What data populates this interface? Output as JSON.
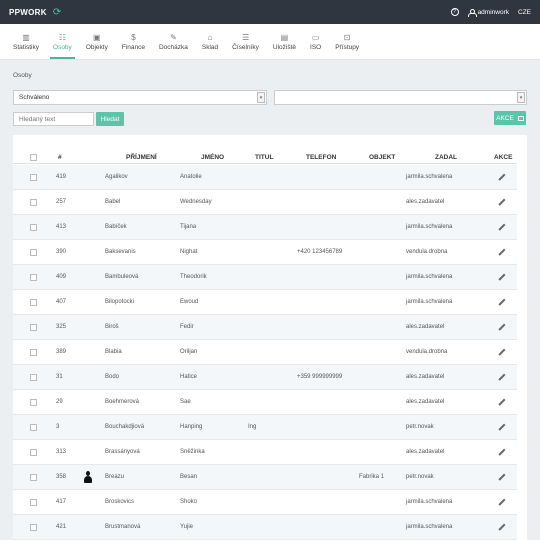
{
  "app": {
    "brand": "PPWORK",
    "username": "adminwork",
    "language": "CZE"
  },
  "nav": [
    {
      "label": "Statistiky",
      "icon": "bar-chart-icon",
      "glyph": "▥"
    },
    {
      "label": "Osoby",
      "icon": "people-icon",
      "glyph": "☷",
      "active": true
    },
    {
      "label": "Objekty",
      "icon": "building-icon",
      "glyph": "▣"
    },
    {
      "label": "Finance",
      "icon": "dollar-icon",
      "glyph": "$"
    },
    {
      "label": "Docházka",
      "icon": "pen-icon",
      "glyph": "✎"
    },
    {
      "label": "Sklad",
      "icon": "warehouse-icon",
      "glyph": "⌂"
    },
    {
      "label": "Číselníky",
      "icon": "list-icon",
      "glyph": "☰"
    },
    {
      "label": "Uložiště",
      "icon": "save-icon",
      "glyph": "▤"
    },
    {
      "label": "ISO",
      "icon": "iso-icon",
      "glyph": "▭"
    },
    {
      "label": "Přístupy",
      "icon": "lock-icon",
      "glyph": "⊡"
    }
  ],
  "page": {
    "breadcrumb": "Osoby",
    "status_filter_value": "Schváleno",
    "second_filter_value": "",
    "search_placeholder": "Hledaný text",
    "search_button": "Hledat",
    "actions_button": "AKCE"
  },
  "table": {
    "headers": {
      "number": "#",
      "surname": "PŘÍJMENÍ",
      "name": "JMÉNO",
      "title": "TITUL",
      "phone": "TELEFON",
      "object": "OBJEKT",
      "entered_by": "ZADAL",
      "actions": "AKCE"
    },
    "rows": [
      {
        "id": "419",
        "surname": "Agalikov",
        "name": "Anatolie",
        "title": "",
        "phone": "",
        "object": "",
        "entered_by": "jarmila.schvalena",
        "avatar": false
      },
      {
        "id": "257",
        "surname": "Babel",
        "name": "Wednesday",
        "title": "",
        "phone": "",
        "object": "",
        "entered_by": "ales.zadavatel",
        "avatar": false
      },
      {
        "id": "413",
        "surname": "Babíček",
        "name": "Tijana",
        "title": "",
        "phone": "",
        "object": "",
        "entered_by": "jarmila.schvalena",
        "avatar": false
      },
      {
        "id": "390",
        "surname": "Baksevanis",
        "name": "Nighat",
        "title": "",
        "phone": "+420 123456789",
        "object": "",
        "entered_by": "vendula.drobna",
        "avatar": false
      },
      {
        "id": "409",
        "surname": "Bambuleová",
        "name": "Theodorik",
        "title": "",
        "phone": "",
        "object": "",
        "entered_by": "jarmila.schvalena",
        "avatar": false
      },
      {
        "id": "407",
        "surname": "Bilopotocki",
        "name": "Ewoud",
        "title": "",
        "phone": "",
        "object": "",
        "entered_by": "jarmila.schvalena",
        "avatar": false
      },
      {
        "id": "325",
        "surname": "Biroš",
        "name": "Fedir",
        "title": "",
        "phone": "",
        "object": "",
        "entered_by": "ales.zadavatel",
        "avatar": false
      },
      {
        "id": "389",
        "surname": "Blabia",
        "name": "Oriljan",
        "title": "",
        "phone": "",
        "object": "",
        "entered_by": "vendula.drobna",
        "avatar": false
      },
      {
        "id": "31",
        "surname": "Bodo",
        "name": "Hatice",
        "title": "",
        "phone": "+359 999999999",
        "object": "",
        "entered_by": "ales.zadavatel",
        "avatar": false
      },
      {
        "id": "29",
        "surname": "Boehmerová",
        "name": "Sae",
        "title": "",
        "phone": "",
        "object": "",
        "entered_by": "ales.zadavatel",
        "avatar": false
      },
      {
        "id": "3",
        "surname": "Bouchakdjiová",
        "name": "Hanping",
        "title": "Ing",
        "phone": "",
        "object": "",
        "entered_by": "petr.novak",
        "avatar": false
      },
      {
        "id": "313",
        "surname": "Brassányová",
        "name": "Sněžinka",
        "title": "",
        "phone": "",
        "object": "",
        "entered_by": "ales.zadavatel",
        "avatar": false
      },
      {
        "id": "358",
        "surname": "Breazu",
        "name": "Besan",
        "title": "",
        "phone": "",
        "object": "Fabrika 1",
        "entered_by": "petr.novak",
        "avatar": true
      },
      {
        "id": "417",
        "surname": "Broskovics",
        "name": "Shoko",
        "title": "",
        "phone": "",
        "object": "",
        "entered_by": "jarmila.schvalena",
        "avatar": false
      },
      {
        "id": "421",
        "surname": "Brustmanová",
        "name": "Yujie",
        "title": "",
        "phone": "",
        "object": "",
        "entered_by": "jarmila.schvalena",
        "avatar": false
      }
    ]
  }
}
